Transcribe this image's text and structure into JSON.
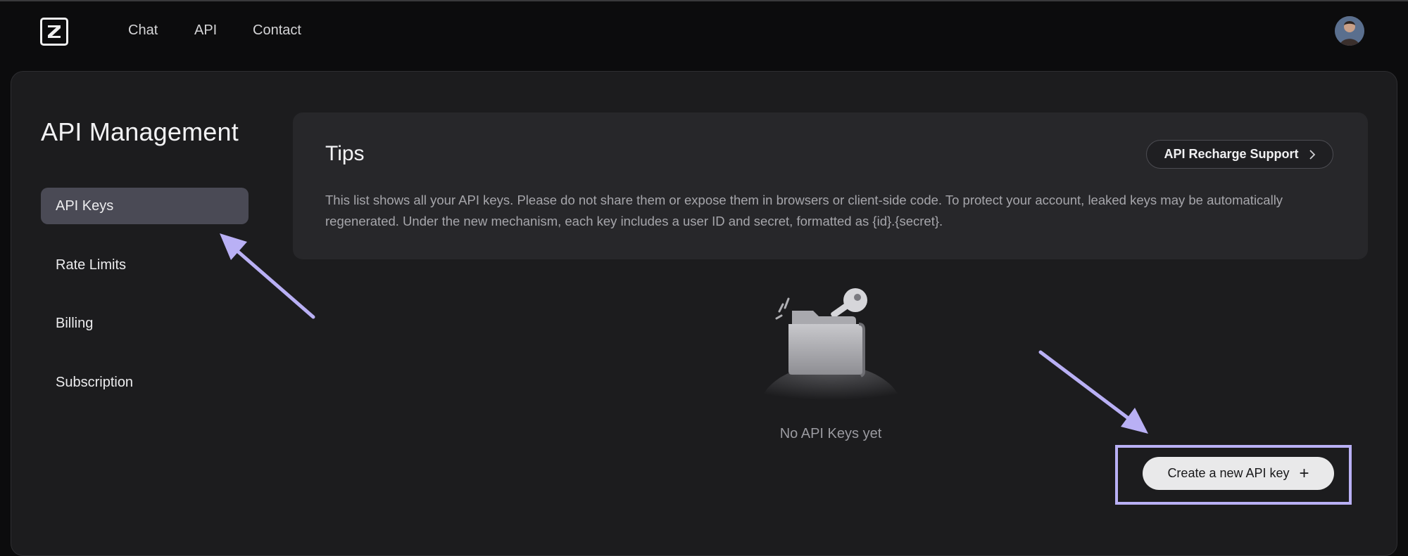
{
  "nav": {
    "logo_letter": "Z",
    "links": [
      "Chat",
      "API",
      "Contact"
    ]
  },
  "sidebar": {
    "title": "API Management",
    "items": [
      {
        "label": "API Keys",
        "active": true
      },
      {
        "label": "Rate Limits",
        "active": false
      },
      {
        "label": "Billing",
        "active": false
      },
      {
        "label": "Subscription",
        "active": false
      }
    ]
  },
  "tips": {
    "title": "Tips",
    "body": "This list shows all your API keys. Please do not share them or expose them in browsers or client-side code. To protect your account, leaked keys may be automatically regenerated. Under the new mechanism, each key includes a user ID and secret, formatted as {id}.{secret}.",
    "recharge_button": "API Recharge Support"
  },
  "empty_state": {
    "text": "No API Keys yet",
    "illustration_icon": "folder-key-icon"
  },
  "actions": {
    "create_button": "Create a new API key",
    "create_icon": "plus-icon"
  },
  "annotations": {
    "color": "#b9b0f5",
    "highlight_target": "create-api-key-button"
  },
  "colors": {
    "background": "#0c0c0d",
    "panel": "#1c1c1e",
    "card": "#27272a",
    "active_item": "#4a4a55",
    "button_light": "#e9e9ea"
  }
}
